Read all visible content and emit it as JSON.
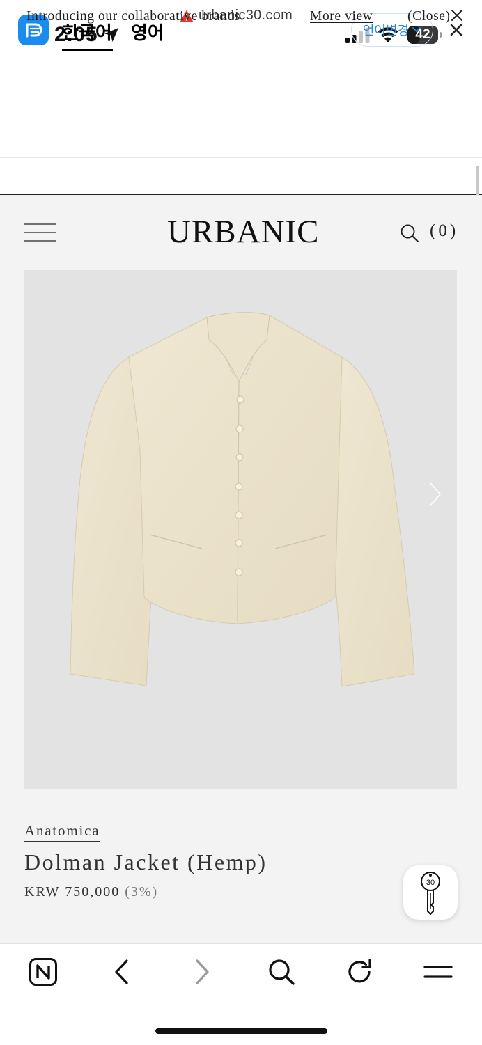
{
  "status_bar": {
    "time": "2:05",
    "battery_percent": "42",
    "battery_level": 0.42
  },
  "browser": {
    "url": "urbanic30.com",
    "url_warning_color": "#e0382b"
  },
  "translate_bar": {
    "source_lang": "한국어",
    "target_lang": "영어",
    "change_label": "언어변경",
    "accent_color": "#1a8cf0"
  },
  "announcement": {
    "text": "Introducing our collaborative brands.",
    "more_label": "More view",
    "close_label": "(Close)"
  },
  "site": {
    "logo": "URBANIC",
    "cart_count": "(0)"
  },
  "product": {
    "brand": "Anatomica",
    "title": "Dolman Jacket (Hemp)",
    "price": "KRW 750,000",
    "discount": "(3%)",
    "image_alt": "jacket"
  },
  "floating_badge": {
    "label": "30"
  },
  "toolbar": {
    "icons": [
      "naver-n-icon",
      "back-icon",
      "forward-icon",
      "search-icon",
      "reload-icon",
      "menu-icon"
    ]
  }
}
